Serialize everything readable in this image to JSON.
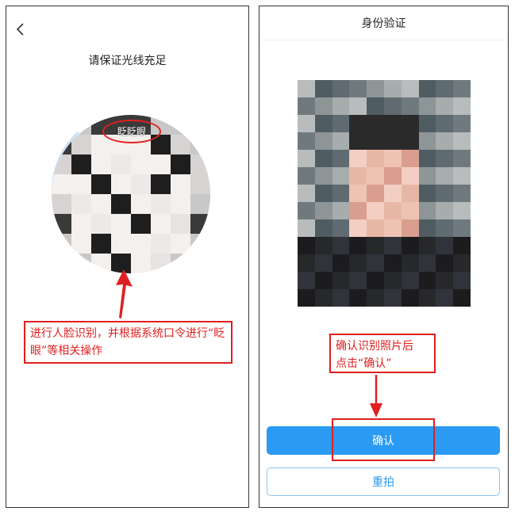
{
  "left": {
    "back_icon": "chevron-left-icon",
    "title": "请保证光线充足",
    "blink_label": "眨眨眼",
    "callout_text": "进行人脸识别，并根据系统口令进行“眨眼”等相关操作",
    "colors": {
      "annotation": "#e02020",
      "arc": "#c9dff5"
    }
  },
  "right": {
    "title": "身份验证",
    "callout_line1": "确认识别照片后",
    "callout_line2": "点击“确认”",
    "confirm_label": "确认",
    "retake_label": "重拍",
    "colors": {
      "primary": "#2a9af2",
      "annotation": "#e02020"
    }
  }
}
